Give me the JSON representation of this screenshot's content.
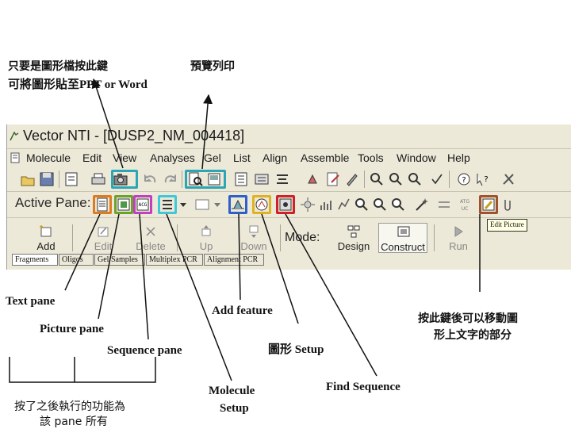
{
  "annotations": {
    "copy_note_line1": "只要是圖形檔按此鍵",
    "copy_note_line2": "可將圖形貼至PPT or Word",
    "print_preview": "預覽列印",
    "text_pane": "Text pane",
    "picture_pane": "Picture pane",
    "sequence_pane": "Sequence pane",
    "add_feature": "Add feature",
    "graphics_setup": "圖形 Setup",
    "molecule_setup_line1": "Molecule",
    "molecule_setup_line2": "Setup",
    "find_sequence": "Find Sequence",
    "edit_picture_note_line1": "按此鍵後可以移動圖",
    "edit_picture_note_line2": "形上文字的部分",
    "pane_function_note_line1": "按了之後執行的功能為",
    "pane_function_note_line2": "該 pane 所有"
  },
  "window": {
    "title": "Vector NTI - [DUSP2_NM_004418]",
    "menu": [
      "Molecule",
      "Edit",
      "View",
      "Analyses",
      "Gel",
      "List",
      "Align",
      "Assemble",
      "Tools",
      "Window",
      "Help"
    ],
    "active_pane_label": "Active Pane:",
    "tooltip": "Edit Picture",
    "big_buttons": [
      "Add",
      "Edit",
      "Delete",
      "Up",
      "Down",
      "Design",
      "Construct",
      "Run"
    ],
    "mode_label": "Mode:",
    "tabs": [
      "Fragments",
      "Oligos",
      "Gel Samples",
      "Multiplex PCR",
      "Alignment PCR"
    ]
  },
  "colors": {
    "copy_highlight": "#2aa6b4",
    "print_preview_highlight": "#2aa6b4",
    "text_pane_highlight": "#e07a1f",
    "picture_pane_highlight": "#6aa32a",
    "sequence_pane_highlight": "#c23fc2",
    "pane_setup_highlight": "#3fc8d8",
    "add_feature_highlight": "#2f5fc9",
    "graphics_setup_highlight": "#e0b21f",
    "find_sequence_highlight": "#d0202a",
    "edit_picture_highlight": "#a0522d"
  }
}
